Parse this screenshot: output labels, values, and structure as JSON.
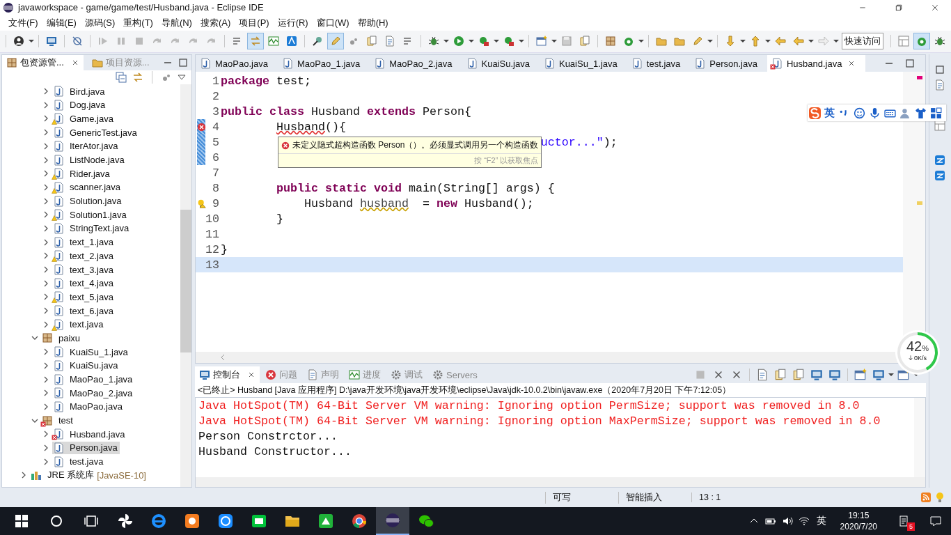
{
  "window": {
    "title": "javaworkspace - game/game/test/Husband.java - Eclipse IDE"
  },
  "menu": [
    "文件(F)",
    "编辑(E)",
    "源码(S)",
    "重构(T)",
    "导航(N)",
    "搜索(A)",
    "项目(P)",
    "运行(R)",
    "窗口(W)",
    "帮助(H)"
  ],
  "toolbar": {
    "toggles": [
      {
        "on": true
      },
      {
        "on": true
      }
    ],
    "quick_access": "快速访问",
    "perspectives": [
      {
        "selected": false
      },
      {
        "selected": true
      },
      {
        "selected": false
      }
    ]
  },
  "explorer": {
    "tabs": [
      {
        "label": "包资源管...",
        "selected": true
      },
      {
        "label": "项目资源...",
        "selected": false
      }
    ],
    "tree": [
      {
        "kind": "file",
        "name": "Bird.java",
        "warning": false,
        "error": false,
        "expanded": false,
        "selected": false
      },
      {
        "kind": "file",
        "name": "Dog.java",
        "warning": false,
        "error": false,
        "expanded": false,
        "selected": false
      },
      {
        "kind": "file",
        "name": "Game.java",
        "warning": true,
        "error": false,
        "expanded": false,
        "selected": false
      },
      {
        "kind": "file",
        "name": "GenericTest.java",
        "warning": false,
        "error": false,
        "expanded": false,
        "selected": false
      },
      {
        "kind": "file",
        "name": "IterAtor.java",
        "warning": false,
        "error": false,
        "expanded": false,
        "selected": false
      },
      {
        "kind": "file",
        "name": "ListNode.java",
        "warning": false,
        "error": false,
        "expanded": false,
        "selected": false
      },
      {
        "kind": "file",
        "name": "Rider.java",
        "warning": true,
        "error": false,
        "expanded": false,
        "selected": false
      },
      {
        "kind": "file",
        "name": "scanner.java",
        "warning": true,
        "error": false,
        "expanded": false,
        "selected": false
      },
      {
        "kind": "file",
        "name": "Solution.java",
        "warning": false,
        "error": false,
        "expanded": false,
        "selected": false
      },
      {
        "kind": "file",
        "name": "Solution1.java",
        "warning": true,
        "error": false,
        "expanded": false,
        "selected": false
      },
      {
        "kind": "file",
        "name": "StringText.java",
        "warning": false,
        "error": false,
        "expanded": false,
        "selected": false
      },
      {
        "kind": "file",
        "name": "text_1.java",
        "warning": false,
        "error": false,
        "expanded": false,
        "selected": false
      },
      {
        "kind": "file",
        "name": "text_2.java",
        "warning": true,
        "error": false,
        "expanded": false,
        "selected": false
      },
      {
        "kind": "file",
        "name": "text_3.java",
        "warning": false,
        "error": false,
        "expanded": false,
        "selected": false
      },
      {
        "kind": "file",
        "name": "text_4.java",
        "warning": false,
        "error": false,
        "expanded": false,
        "selected": false
      },
      {
        "kind": "file",
        "name": "text_5.java",
        "warning": true,
        "error": false,
        "expanded": false,
        "selected": false
      },
      {
        "kind": "file",
        "name": "text_6.java",
        "warning": false,
        "error": false,
        "expanded": false,
        "selected": false
      },
      {
        "kind": "file",
        "name": "text.java",
        "warning": true,
        "error": false,
        "expanded": false,
        "selected": false
      },
      {
        "kind": "package",
        "name": "paixu",
        "warning": false,
        "error": false,
        "expanded": true,
        "selected": false,
        "children": [
          {
            "kind": "file",
            "name": "KuaiSu_1.java",
            "warning": false,
            "error": false,
            "expanded": false,
            "selected": false
          },
          {
            "kind": "file",
            "name": "KuaiSu.java",
            "warning": false,
            "error": false,
            "expanded": false,
            "selected": false
          },
          {
            "kind": "file",
            "name": "MaoPao_1.java",
            "warning": false,
            "error": false,
            "expanded": false,
            "selected": false
          },
          {
            "kind": "file",
            "name": "MaoPao_2.java",
            "warning": false,
            "error": false,
            "expanded": false,
            "selected": false
          },
          {
            "kind": "file",
            "name": "MaoPao.java",
            "warning": false,
            "error": false,
            "expanded": false,
            "selected": false
          }
        ]
      },
      {
        "kind": "package",
        "name": "test",
        "warning": false,
        "error": true,
        "expanded": true,
        "selected": false,
        "children": [
          {
            "kind": "file",
            "name": "Husband.java",
            "warning": false,
            "error": true,
            "expanded": false,
            "selected": false
          },
          {
            "kind": "file",
            "name": "Person.java",
            "warning": false,
            "error": false,
            "expanded": false,
            "selected": true
          },
          {
            "kind": "file",
            "name": "test.java",
            "warning": false,
            "error": false,
            "expanded": false,
            "selected": false
          }
        ]
      },
      {
        "kind": "library",
        "name": "JRE 系统库",
        "detail": "[JavaSE-10]",
        "warning": false,
        "error": false,
        "expanded": false,
        "selected": false
      }
    ]
  },
  "editor": {
    "tabs": [
      {
        "label": "MaoPao.java",
        "selected": false,
        "error": false
      },
      {
        "label": "MaoPao_1.java",
        "selected": false,
        "error": false
      },
      {
        "label": "MaoPao_2.java",
        "selected": false,
        "error": false
      },
      {
        "label": "KuaiSu.java",
        "selected": false,
        "error": false
      },
      {
        "label": "KuaiSu_1.java",
        "selected": false,
        "error": false
      },
      {
        "label": "test.java",
        "selected": false,
        "error": false
      },
      {
        "label": "Person.java",
        "selected": false,
        "error": false
      },
      {
        "label": "Husband.java",
        "selected": true,
        "error": true
      }
    ],
    "lines": [
      {
        "number": "1",
        "error": false,
        "warning": false,
        "range": false,
        "current": false,
        "tokens": [
          {
            "kind": "kw",
            "t": "package"
          },
          {
            "kind": "plain",
            "t": " test;"
          }
        ]
      },
      {
        "number": "2",
        "error": false,
        "warning": false,
        "range": false,
        "current": false
      },
      {
        "number": "3",
        "error": false,
        "warning": false,
        "range": false,
        "current": false,
        "tokens": [
          {
            "kind": "kw",
            "t": "public"
          },
          {
            "kind": "kw",
            "t": " class"
          },
          {
            "kind": "plain",
            "t": " Husband "
          },
          {
            "kind": "kw",
            "t": "extends"
          },
          {
            "kind": "plain",
            "t": " Person{"
          }
        ]
      },
      {
        "number": "4",
        "error": true,
        "warning": false,
        "range": true,
        "current": false,
        "tokens": [
          {
            "kind": "error",
            "t": "        Husband"
          },
          {
            "kind": "plain",
            "t": "(){"
          }
        ]
      },
      {
        "number": "5",
        "error": false,
        "warning": false,
        "range": true,
        "current": false,
        "tokens": [
          {
            "kind": "string",
            "t": "                                              uctor...\""
          },
          {
            "kind": "plain",
            "t": ");"
          }
        ]
      },
      {
        "number": "6",
        "error": false,
        "warning": false,
        "range": true,
        "current": false
      },
      {
        "number": "7",
        "error": false,
        "warning": false,
        "range": false,
        "current": false
      },
      {
        "number": "8",
        "error": false,
        "warning": false,
        "range": false,
        "current": false,
        "tokens": [
          {
            "kind": "kw",
            "t": "        public"
          },
          {
            "kind": "kw",
            "t": " static"
          },
          {
            "kind": "kw",
            "t": " void"
          },
          {
            "kind": "plain",
            "t": " main(String[] args) {"
          }
        ]
      },
      {
        "number": "9",
        "error": false,
        "warning": true,
        "range": false,
        "current": false,
        "tokens": [
          {
            "kind": "plain",
            "t": "            Husband "
          },
          {
            "kind": "warning",
            "t": "husband"
          },
          {
            "kind": "plain",
            "t": "  = "
          },
          {
            "kind": "kw",
            "t": "new"
          },
          {
            "kind": "plain",
            "t": " Husband();"
          }
        ]
      },
      {
        "number": "10",
        "error": false,
        "warning": false,
        "range": false,
        "current": false,
        "tokens": [
          {
            "kind": "plain",
            "t": "        }"
          }
        ]
      },
      {
        "number": "11",
        "error": false,
        "warning": false,
        "range": false,
        "current": false
      },
      {
        "number": "12",
        "error": false,
        "warning": false,
        "range": false,
        "current": false,
        "tokens": [
          {
            "kind": "plain",
            "t": "}"
          }
        ]
      },
      {
        "number": "13",
        "error": false,
        "warning": false,
        "range": false,
        "current": true
      }
    ],
    "tooltip": {
      "message": "未定义隐式超构造函数 Person（）。必须显式调用另一个构造函数",
      "hint": "按 “F2” 以获取焦点"
    }
  },
  "console": {
    "tabs": [
      {
        "label": "控制台",
        "selected": true
      },
      {
        "label": "问题",
        "selected": false
      },
      {
        "label": "声明",
        "selected": false
      },
      {
        "label": "进度",
        "selected": false
      },
      {
        "label": "调试",
        "selected": false
      },
      {
        "label": "Servers",
        "selected": false
      }
    ],
    "info": "<已终止> Husband [Java 应用程序] D:\\java开发环境\\java开发环境\\eclipse\\Java\\jdk-10.0.2\\bin\\javaw.exe（2020年7月20日 下午7:12:05）",
    "lines": [
      {
        "kind": "stderr",
        "text": "Java HotSpot(TM) 64-Bit Server VM warning: Ignoring option PermSize; support was removed in 8.0"
      },
      {
        "kind": "stderr",
        "text": "Java HotSpot(TM) 64-Bit Server VM warning: Ignoring option MaxPermSize; support was removed in 8.0"
      },
      {
        "kind": "stdout",
        "text": "Person Constrctor..."
      },
      {
        "kind": "stdout",
        "text": "Husband Constructor..."
      }
    ]
  },
  "status_bar": [
    "可写",
    "智能插入",
    "13 : 1"
  ],
  "ime": {
    "mode": "英"
  },
  "network": {
    "level": 0.42,
    "percent": "42",
    "unit": "%",
    "speed": "0K/s"
  },
  "taskbar": {
    "apps": [
      {
        "kind": "pinwheel",
        "selected": false
      },
      {
        "kind": "browser",
        "selected": false
      },
      {
        "kind": "ring",
        "selected": false
      },
      {
        "kind": "circle",
        "selected": false
      },
      {
        "kind": "tv",
        "selected": false
      },
      {
        "kind": "folder",
        "selected": false
      },
      {
        "kind": "triangle",
        "selected": false
      },
      {
        "kind": "wheel",
        "selected": false
      },
      {
        "kind": "disc",
        "selected": true
      },
      {
        "kind": "chat",
        "selected": false
      }
    ],
    "language": "英",
    "time": "19:15",
    "date": "2020/7/20",
    "notifications": "5"
  }
}
